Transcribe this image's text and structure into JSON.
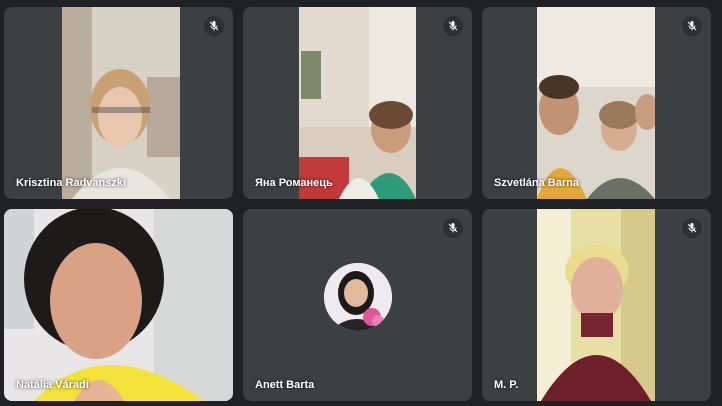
{
  "participants": [
    {
      "name": "Krisztina Radvanszki",
      "muted": true,
      "icon": "mic-off-icon"
    },
    {
      "name": "Яна Романець",
      "muted": true,
      "icon": "mic-off-icon"
    },
    {
      "name": "Szvetlána Barna",
      "muted": true,
      "icon": "mic-off-icon"
    },
    {
      "name": "Natália Váradi",
      "muted": false
    },
    {
      "name": "Anett Barta",
      "muted": true,
      "icon": "mic-off-icon",
      "video": false
    },
    {
      "name": "M. P.",
      "muted": true,
      "icon": "mic-off-icon"
    }
  ],
  "colors": {
    "background": "#202124",
    "tile": "#3c4043",
    "name_text": "#ffffff"
  }
}
